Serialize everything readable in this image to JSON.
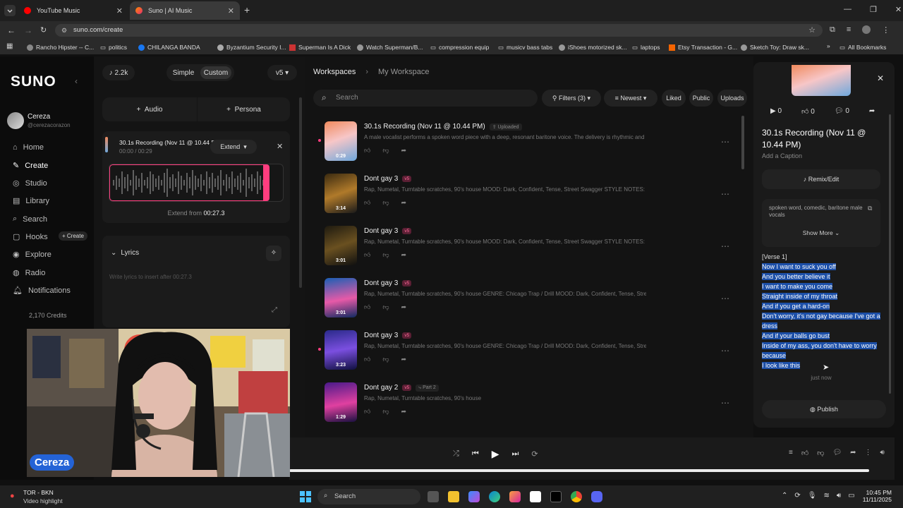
{
  "browser": {
    "tabs": [
      {
        "title": "YouTube Music",
        "active": false
      },
      {
        "title": "Suno | AI Music",
        "active": true
      }
    ],
    "url": "suno.com/create",
    "bookmarks": [
      "Rancho Hipster -- C...",
      "politics",
      "CHILANGA BANDA",
      "Byzantium Security I...",
      "Superman Is A Dick",
      "Watch Superman/B...",
      "compression equip",
      "musicv bass tabs",
      "iShoes motorized sk...",
      "laptops",
      "Etsy Transaction - G...",
      "Sketch Toy: Draw sk..."
    ],
    "all_bookmarks": "All Bookmarks"
  },
  "sidebar": {
    "logo": "SUNO",
    "user_name": "Cereza",
    "user_handle": "@cerezacorazon",
    "items": [
      "Home",
      "Create",
      "Studio",
      "Library",
      "Search",
      "Hooks",
      "Explore",
      "Radio",
      "Notifications"
    ],
    "hooks_create": "+ Create",
    "credits": "2,170 Credits"
  },
  "create_panel": {
    "notes_count": "2.2k",
    "mode_simple": "Simple",
    "mode_custom": "Custom",
    "version": "v5",
    "audio_btn": "Audio",
    "persona_btn": "Persona",
    "clip_title": "30.1s Recording (Nov 11 @ 10.44 PM)",
    "clip_time": "00:00 / 00:29",
    "extend_btn": "Extend",
    "extend_from_label": "Extend from",
    "extend_from_time": "00:27.3",
    "lyrics_label": "Lyrics",
    "lyrics_placeholder": "Write lyrics to insert after 00:27.3"
  },
  "workspace": {
    "crumb_root": "Workspaces",
    "crumb_current": "My Workspace",
    "search_placeholder": "Search",
    "filters": "Filters (3)",
    "sort": "Newest",
    "chip_liked": "Liked",
    "chip_public": "Public",
    "chip_uploads": "Uploads",
    "songs": [
      {
        "title": "30.1s Recording (Nov 11 @ 10.44 PM)",
        "tag": "Uploaded",
        "desc": "A male vocalist performs a spoken word piece with a deep, resonant baritone voice. The delivery is rhythmic and co...",
        "duration": "0:29",
        "grad": "linear-gradient(160deg,#f08a5d,#f7c6c7 45%,#6fa8dc)"
      },
      {
        "title": "Dont gay 3",
        "tag": "v5",
        "desc": "Rap, Numetal, Turntable scratches, 90's house MOOD: Dark, Confident, Tense, Street Swagger STYLE NOTES: - 2-l...",
        "duration": "3:14",
        "grad": "linear-gradient(160deg,#3a2a10,#b07a2a 50%,#1a1a1a)"
      },
      {
        "title": "Dont gay 3",
        "tag": "v5",
        "desc": "Rap, Numetal, Turntable scratches, 90's house MOOD: Dark, Confident, Tense, Street Swagger STYLE NOTES: - 2-l...",
        "duration": "3:01",
        "grad": "linear-gradient(160deg,#1e1a10,#6a5020 50%,#101010)"
      },
      {
        "title": "Dont gay 3",
        "tag": "v5",
        "desc": "Rap, Numetal, Turntable scratches, 90's house GENRE: Chicago Trap / Drill MOOD: Dark, Confident, Tense, Street S...",
        "duration": "3:01",
        "grad": "linear-gradient(170deg,#1a5fb4,#e75aa8 55%,#102a60)"
      },
      {
        "title": "Dont gay 3",
        "tag": "v5",
        "desc": "Rap, Numetal, Turntable scratches, 90's house GENRE: Chicago Trap / Drill MOOD: Dark, Confident, Tense, Street S...",
        "duration": "3:23",
        "grad": "linear-gradient(170deg,#2a2a8a,#7b4fe0 50%,#101040)"
      },
      {
        "title": "Dont gay 2",
        "tag": "v5",
        "tag2": "Part 2",
        "desc": "Rap, Numetal, Turntable scratches, 90's house",
        "duration": "1:29",
        "grad": "linear-gradient(170deg,#4a1a8a,#e040a0 55%,#1a1040)"
      }
    ]
  },
  "detail": {
    "plays": "0",
    "likes": "0",
    "comments": "0",
    "title": "30.1s Recording (Nov 11 @ 10.44 PM)",
    "caption": "Add a Caption",
    "remix": "Remix/Edit",
    "style": "spoken word, comedic, baritone male vocals",
    "show_more": "Show More",
    "verse": "[Verse 1]",
    "lyrics": [
      "Now I want to suck you off",
      "And you better believe it",
      "I want to make you come",
      "Straight inside of my throat",
      "And if you get a hard-on",
      "Don't worry, it's not gay because I've got a dress",
      "And if your balls go bust",
      "Inside of my ass, you don't have to worry because",
      "I look like this"
    ],
    "timestamp": "just now",
    "publish": "Publish"
  },
  "webcam": {
    "label": "Cereza"
  },
  "taskbar": {
    "weather_team": "TOR - BKN",
    "weather_sub": "Video highlight",
    "search": "Search",
    "time": "10:45 PM",
    "date": "11/11/2025"
  },
  "colors": {
    "accent_pink": "#ff3d7f",
    "highlight_blue": "#1c4fa8"
  }
}
